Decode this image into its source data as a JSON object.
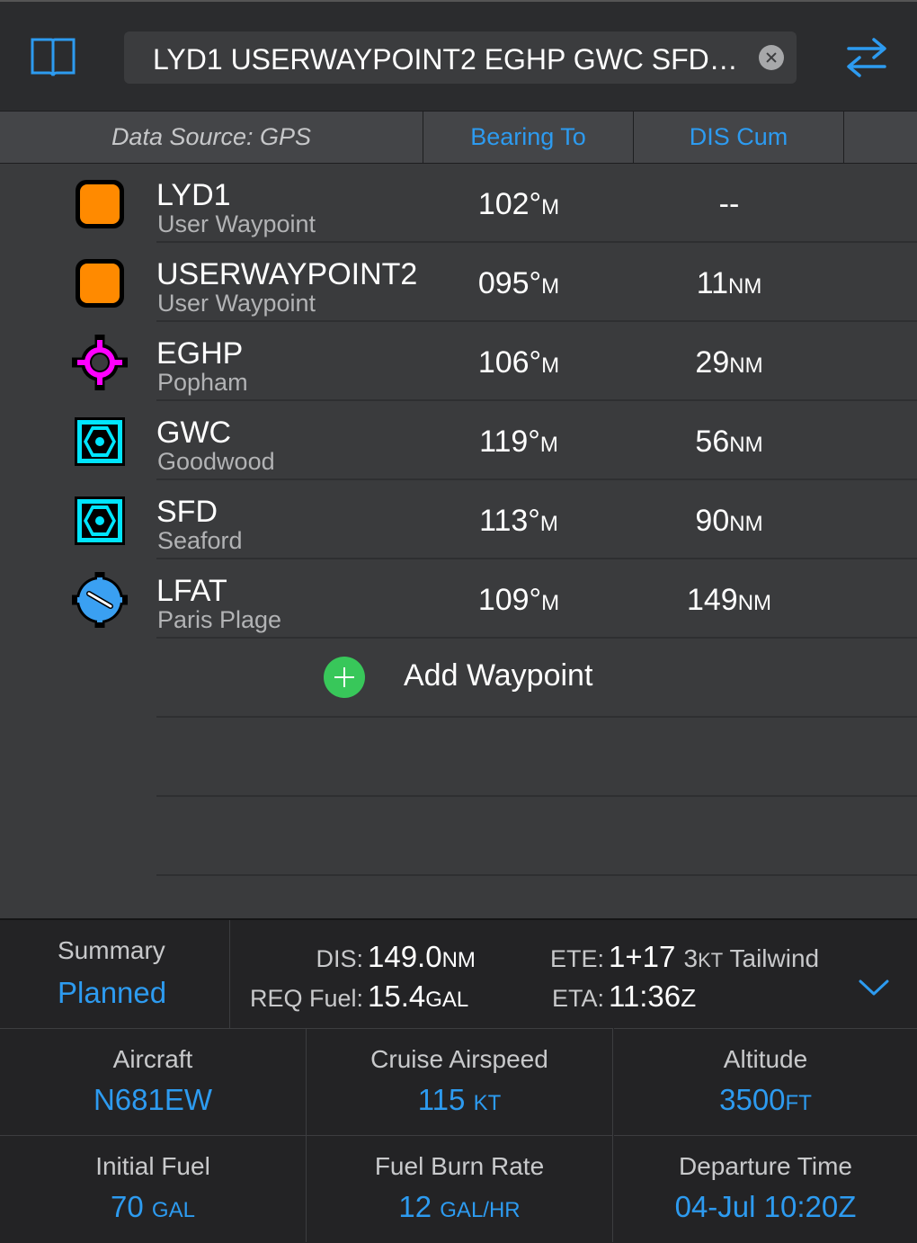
{
  "top_bar": {
    "route": "LYD1 USERWAYPOINT2 EGHP GWC SFD…",
    "book_icon": "book-icon",
    "clear_icon": "clear-icon",
    "swap_icon": "swap-arrows-icon"
  },
  "header": {
    "source": "Data Source: GPS",
    "col1": "Bearing To",
    "col2": "DIS Cum"
  },
  "waypoints": [
    {
      "id": "LYD1",
      "name": "User Waypoint",
      "bearing": "102°",
      "bearing_unit": "M",
      "dis": "--",
      "dis_unit": "",
      "icon": "user-waypoint-icon"
    },
    {
      "id": "USERWAYPOINT2",
      "name": "User Waypoint",
      "bearing": "095°",
      "bearing_unit": "M",
      "dis": "11",
      "dis_unit": "NM",
      "icon": "user-waypoint-icon"
    },
    {
      "id": "EGHP",
      "name": "Popham",
      "bearing": "106°",
      "bearing_unit": "M",
      "dis": "29",
      "dis_unit": "NM",
      "icon": "airport-icon"
    },
    {
      "id": "GWC",
      "name": "Goodwood",
      "bearing": "119°",
      "bearing_unit": "M",
      "dis": "56",
      "dis_unit": "NM",
      "icon": "vor-icon"
    },
    {
      "id": "SFD",
      "name": "Seaford",
      "bearing": "113°",
      "bearing_unit": "M",
      "dis": "90",
      "dis_unit": "NM",
      "icon": "vor-icon"
    },
    {
      "id": "LFAT",
      "name": "Paris Plage",
      "bearing": "109°",
      "bearing_unit": "M",
      "dis": "149",
      "dis_unit": "NM",
      "icon": "towered-airport-icon"
    }
  ],
  "add_waypoint": "Add Waypoint",
  "summary": {
    "title": "Summary",
    "mode": "Planned",
    "dis_label": "DIS:",
    "dis_value": "149.0",
    "dis_unit": "NM",
    "fuel_label": "REQ Fuel:",
    "fuel_value": "15.4",
    "fuel_unit": "GAL",
    "ete_label": "ETE:",
    "ete_value": "1+17",
    "wind_value": "3",
    "wind_unit": "KT",
    "wind_text": "Tailwind",
    "eta_label": "ETA:",
    "eta_value": "11:36",
    "eta_unit": "Z"
  },
  "settings": {
    "aircraft_label": "Aircraft",
    "aircraft_value": "N681EW",
    "airspeed_label": "Cruise Airspeed",
    "airspeed_value": "115",
    "airspeed_unit": "KT",
    "altitude_label": "Altitude",
    "altitude_value": "3500",
    "altitude_unit": "FT",
    "fuel_label": "Initial Fuel",
    "fuel_value": "70",
    "fuel_unit": "GAL",
    "burn_label": "Fuel Burn Rate",
    "burn_value": "12",
    "burn_unit": "GAL/HR",
    "departure_label": "Departure Time",
    "departure_value": "04-Jul 10:20",
    "departure_unit": "Z"
  },
  "colors": {
    "accent": "#2d9bf0",
    "user_waypoint": "#ff8a00",
    "airport": "#ff00ff",
    "vor": "#00e5ff",
    "towered_airport": "#3aa0f2",
    "add": "#38c75a"
  }
}
